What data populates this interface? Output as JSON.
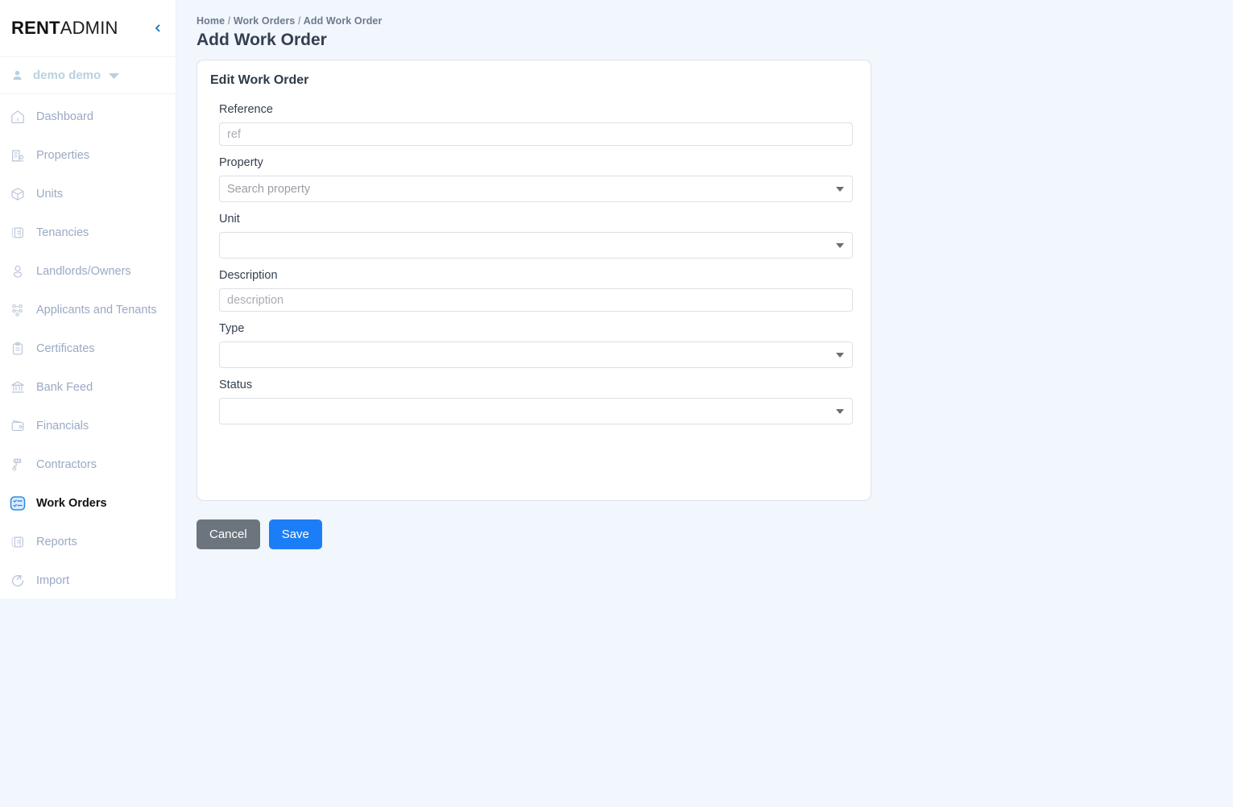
{
  "sidebar": {
    "logo": {
      "bold": "RENT",
      "light": "ADMIN"
    },
    "collapse_icon": "chevron-left-icon",
    "user": {
      "name": "demo demo",
      "avatar_icon": "user-icon",
      "caret_icon": "chevron-down-icon"
    },
    "items": [
      {
        "label": "Dashboard",
        "icon": "home-pentagon-icon",
        "active": false
      },
      {
        "label": "Properties",
        "icon": "building-icon",
        "active": false
      },
      {
        "label": "Units",
        "icon": "cube-icon",
        "active": false
      },
      {
        "label": "Tenancies",
        "icon": "documents-icon",
        "active": false
      },
      {
        "label": "Landlords/Owners",
        "icon": "person-icon",
        "active": false
      },
      {
        "label": "Applicants and Tenants",
        "icon": "people-network-icon",
        "active": false
      },
      {
        "label": "Certificates",
        "icon": "clipboard-icon",
        "active": false
      },
      {
        "label": "Bank Feed",
        "icon": "bank-icon",
        "active": false
      },
      {
        "label": "Financials",
        "icon": "wallet-icon",
        "active": false
      },
      {
        "label": "Contractors",
        "icon": "tool-icon",
        "active": false
      },
      {
        "label": "Work Orders",
        "icon": "checklist-icon",
        "active": true
      },
      {
        "label": "Reports",
        "icon": "report-icon",
        "active": false
      },
      {
        "label": "Import",
        "icon": "import-arrow-icon",
        "active": false
      }
    ]
  },
  "breadcrumb": {
    "home": "Home",
    "section": "Work Orders",
    "current": "Add Work Order",
    "separator": "/"
  },
  "page": {
    "title": "Add Work Order"
  },
  "card": {
    "title": "Edit Work Order",
    "fields": {
      "reference": {
        "label": "Reference",
        "value": "",
        "placeholder": "ref"
      },
      "property": {
        "label": "Property",
        "value": "",
        "placeholder": "Search property"
      },
      "unit": {
        "label": "Unit",
        "value": "",
        "placeholder": ""
      },
      "description": {
        "label": "Description",
        "value": "",
        "placeholder": "description"
      },
      "type": {
        "label": "Type",
        "value": "",
        "placeholder": ""
      },
      "status": {
        "label": "Status",
        "value": "",
        "placeholder": ""
      }
    }
  },
  "actions": {
    "cancel_label": "Cancel",
    "save_label": "Save"
  },
  "colors": {
    "page_bg": "#f2f6fd",
    "sidebar_bg": "#ffffff",
    "accent_blue": "#1b7ef7",
    "cancel_gray": "#6c757d",
    "nav_text": "#9aa9c4",
    "title_text": "#34404f"
  }
}
